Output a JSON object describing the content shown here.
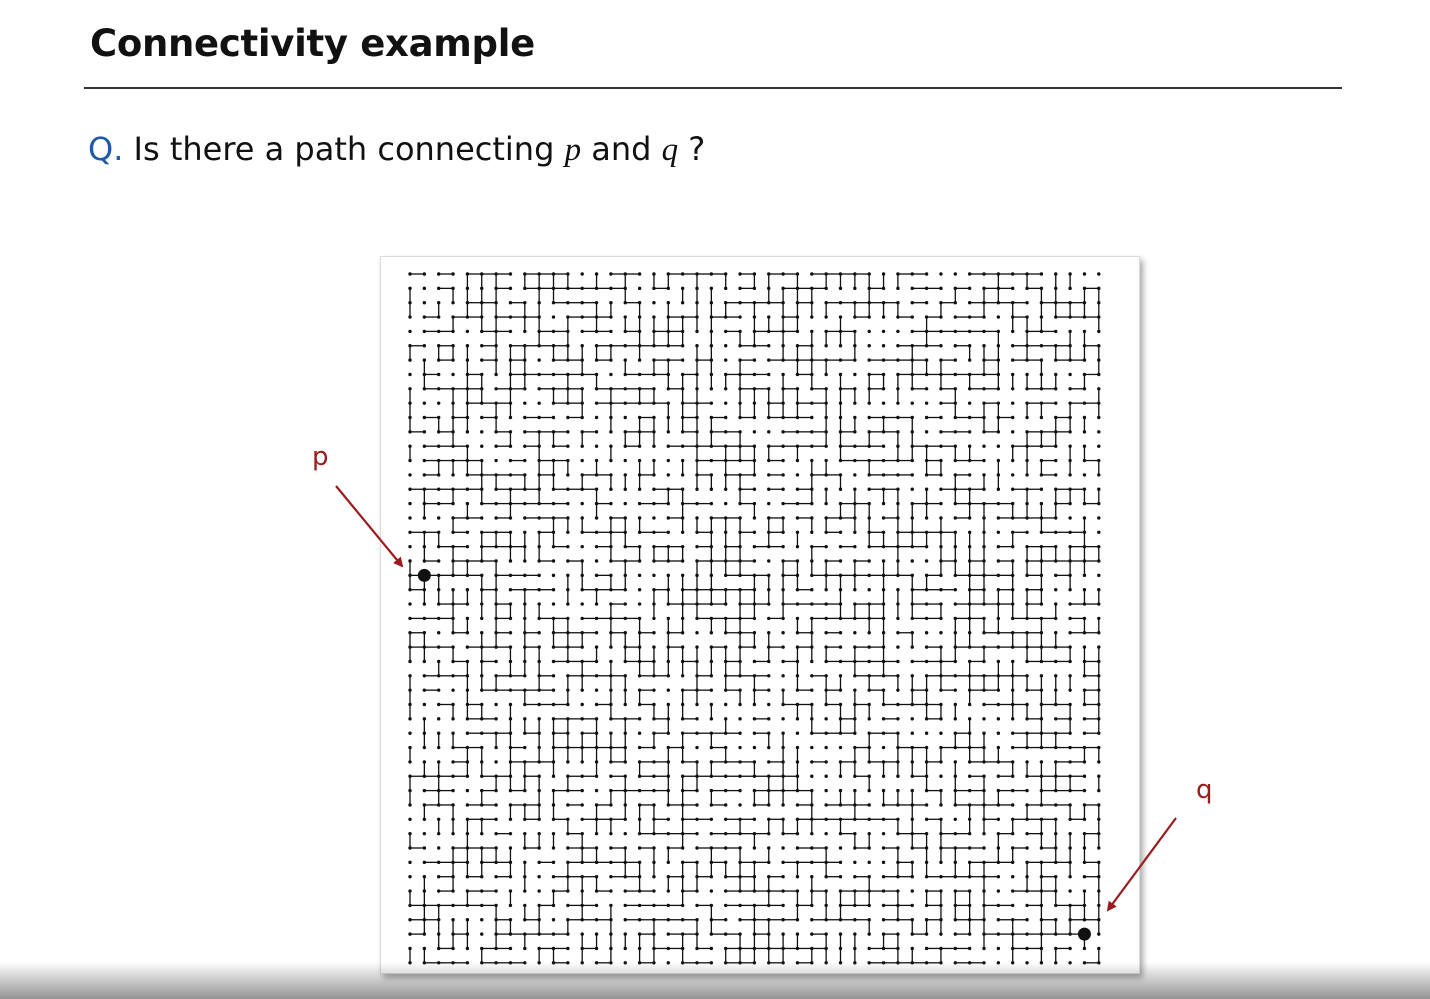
{
  "slide": {
    "title": "Connectivity example",
    "question": {
      "prefix": "Q.",
      "text_before": "Is there a path connecting",
      "var_p": "p",
      "text_mid": "and",
      "var_q": "q",
      "text_after": "?"
    }
  },
  "figure": {
    "grid_rows": 49,
    "grid_cols": 49,
    "site_color": "#111111",
    "site_p": {
      "label": "p",
      "row": 21,
      "col": 1
    },
    "site_q": {
      "label": "q",
      "row": 46,
      "col": 47
    },
    "arrow_color": "#9b1c1c"
  }
}
